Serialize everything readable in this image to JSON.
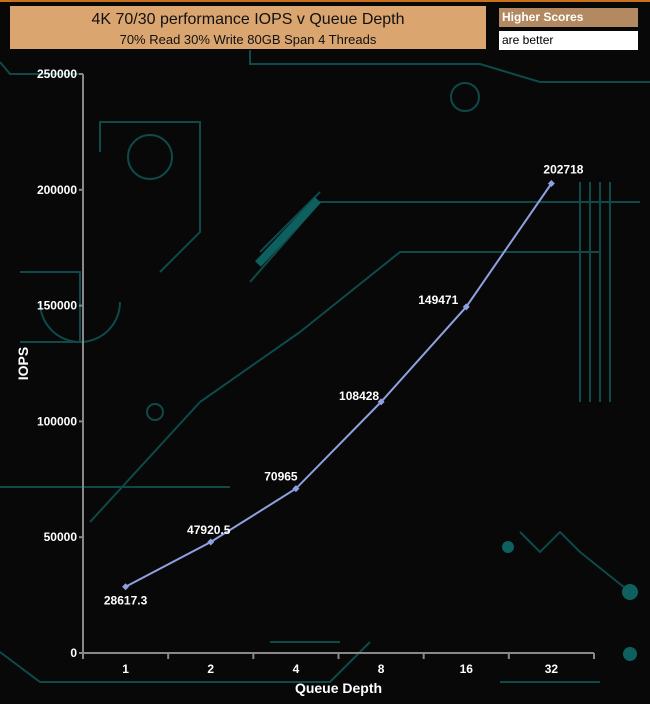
{
  "legend": {
    "line1": "Higher Scores",
    "line2": "are better"
  },
  "chart_data": {
    "type": "line",
    "title": "4K 70/30 performance IOPS v Queue Depth",
    "subtitle": "70% Read 30% Write 80GB Span 4 Threads",
    "xlabel": "Queue Depth",
    "ylabel": "IOPS",
    "categories": [
      "1",
      "2",
      "4",
      "8",
      "16",
      "32"
    ],
    "series": [
      {
        "name": "IOPS",
        "values": [
          28617.3,
          47920.5,
          70965,
          108428,
          149471,
          202718
        ],
        "labels": [
          "28617.3",
          "47920.5",
          "70965",
          "108428",
          "149471",
          "202718"
        ]
      }
    ],
    "ylim": [
      0,
      250000
    ],
    "yticks": [
      "0",
      "50000",
      "100000",
      "150000",
      "200000",
      "250000"
    ],
    "line_color": "#8fa0e0"
  }
}
